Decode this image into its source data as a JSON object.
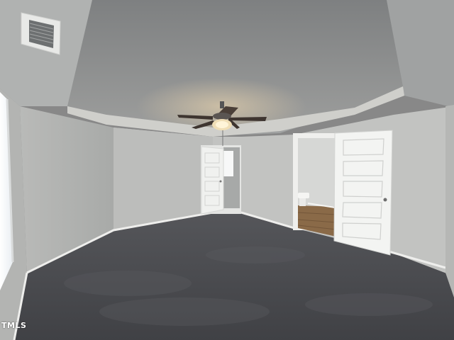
{
  "photo": {
    "watermark": "TMLS",
    "subject": "empty-bedroom",
    "features": [
      "tray-ceiling",
      "ceiling-fan",
      "hvac-vent",
      "carpet-floor",
      "closet-door",
      "bathroom-door",
      "window"
    ]
  },
  "colors": {
    "ceiling": "#8b8d8e",
    "tray": "#a7a9a9",
    "wall": "#c3c4c2",
    "wall_shadow": "#a3a5a4",
    "carpet": "#4a4b4f",
    "door": "#f2f3f1",
    "wood_floor": "#8a6a48",
    "fan_blade": "#3e3530"
  }
}
